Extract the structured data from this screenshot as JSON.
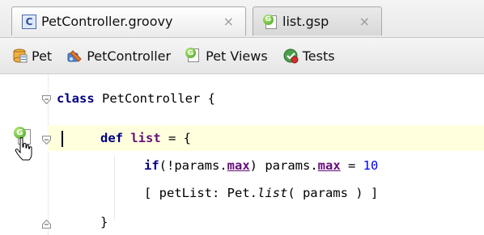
{
  "tabs": [
    {
      "label": "PetController.groovy",
      "icon": "class-file-icon",
      "active": true
    },
    {
      "label": "list.gsp",
      "icon": "grails-view-icon",
      "active": false
    }
  ],
  "tab_close_glyph": "×",
  "navbar": {
    "items": [
      {
        "label": "Pet",
        "icon": "domain-class-icon"
      },
      {
        "label": "PetController",
        "icon": "controller-icon"
      },
      {
        "label": "Pet Views",
        "icon": "grails-view-icon"
      },
      {
        "label": "Tests",
        "icon": "tests-icon"
      }
    ]
  },
  "code": {
    "line1": {
      "kw": "class",
      "text": " PetController {"
    },
    "line2": {
      "kw": "def",
      "name": "list",
      "text": " = {"
    },
    "line3": {
      "pre": "if(!params.",
      "u1": "max",
      "mid": ") params.",
      "u2": "max",
      "eq": " = ",
      "num": "10"
    },
    "line4": {
      "pre": "[ petList: Pet.",
      "it": "list",
      "post": "( params ) ]"
    },
    "line5": {
      "text": "}"
    }
  },
  "colors": {
    "current_line": "#ffffde",
    "keyword": "#000080",
    "field": "#660e7a",
    "number": "#0000ff"
  }
}
